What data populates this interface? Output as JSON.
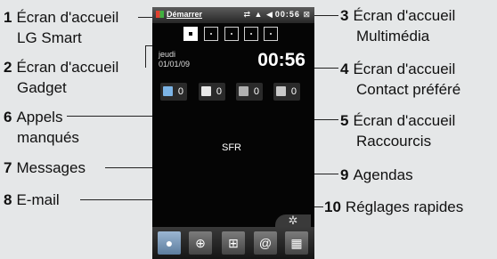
{
  "labels": {
    "l1": {
      "num": "1",
      "line1": "Écran d'accueil",
      "line2": "LG Smart"
    },
    "l2": {
      "num": "2",
      "line1": "Écran d'accueil",
      "line2": "Gadget"
    },
    "l3": {
      "num": "3",
      "line1": "Écran d'accueil",
      "line2": "Multimédia"
    },
    "l4": {
      "num": "4",
      "line1": "Écran d'accueil",
      "line2": "Contact préféré"
    },
    "l5": {
      "num": "5",
      "line1": "Écran d'accueil",
      "line2": "Raccourcis"
    },
    "l6": {
      "num": "6",
      "line1": "Appels",
      "line2": "manqués"
    },
    "l7": {
      "num": "7",
      "line1": "Messages"
    },
    "l8": {
      "num": "8",
      "line1": "E-mail"
    },
    "l9": {
      "num": "9",
      "line1": "Agendas"
    },
    "l10": {
      "num": "10",
      "line1": "Réglages rapides"
    }
  },
  "phone": {
    "start_label": "Démarrer",
    "status_time": "00:56",
    "date_day": "jeudi",
    "date_value": "01/01/09",
    "clock": "00:56",
    "operator": "SFR",
    "tiles": {
      "calls": "0",
      "messages": "0",
      "email": "0",
      "agenda": "0"
    },
    "active_screen": 1
  }
}
